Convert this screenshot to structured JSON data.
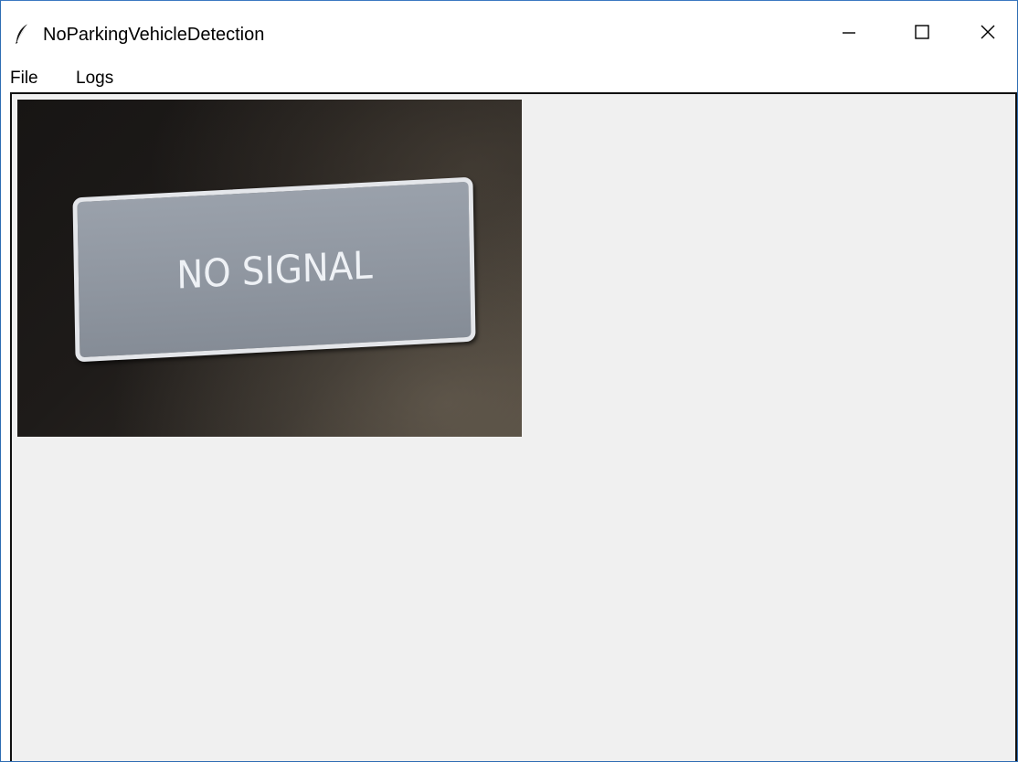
{
  "window": {
    "title": "NoParkingVehicleDetection",
    "app_icon": "feather-icon",
    "controls": {
      "minimize_icon": "minimize-icon",
      "maximize_icon": "maximize-icon",
      "close_icon": "close-icon"
    }
  },
  "menubar": {
    "items": [
      {
        "label": "File"
      },
      {
        "label": "Logs"
      }
    ]
  },
  "video": {
    "status_text": "NO SIGNAL"
  },
  "colors": {
    "client_background": "#f0f0f0",
    "window_border": "#2f6db3",
    "signal_plate": "#959ca6"
  }
}
